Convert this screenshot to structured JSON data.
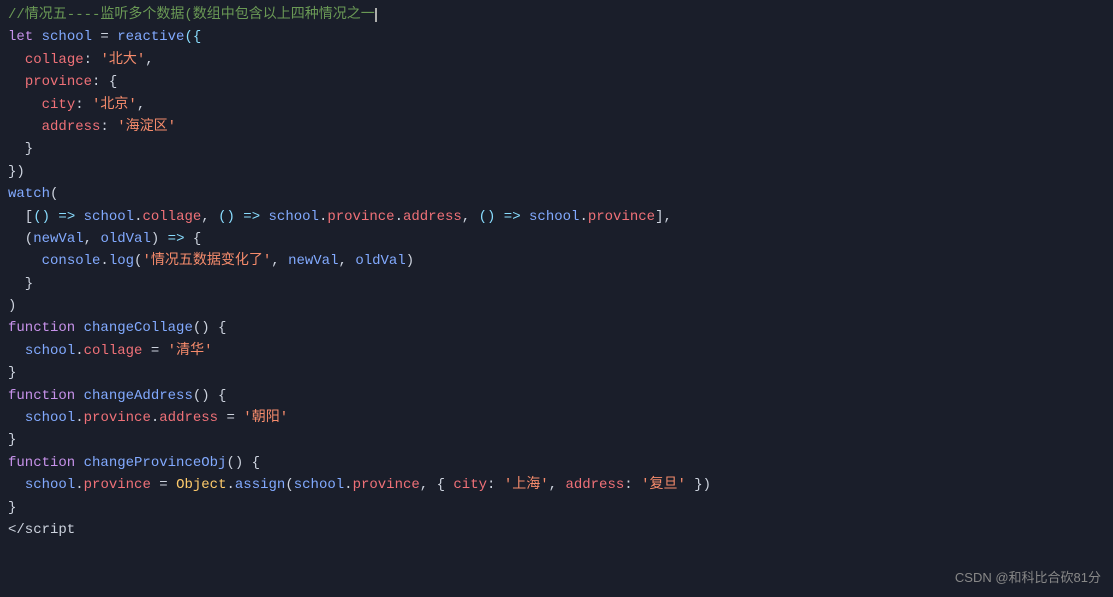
{
  "editor": {
    "background": "#1a1e2a",
    "watermark": "CSDN @和科比合砍81分"
  },
  "lines": [
    {
      "id": 1,
      "type": "comment",
      "text": "//情况五----监听多个数据(数组中包含以上四种情况之一"
    },
    {
      "id": 2,
      "type": "code",
      "text": "let school = reactive({"
    },
    {
      "id": 3,
      "type": "code",
      "text": "  collage: '北大',"
    },
    {
      "id": 4,
      "type": "code",
      "text": "  province: {"
    },
    {
      "id": 5,
      "type": "code",
      "text": "    city: '北京',"
    },
    {
      "id": 6,
      "type": "code",
      "text": "    address: '海淀区'"
    },
    {
      "id": 7,
      "type": "code",
      "text": "  }"
    },
    {
      "id": 8,
      "type": "code",
      "text": "})"
    },
    {
      "id": 9,
      "type": "code",
      "text": "watch("
    },
    {
      "id": 10,
      "type": "code",
      "text": "  [() => school.collage, () => school.province.address, () => school.province],"
    },
    {
      "id": 11,
      "type": "code",
      "text": "  (newVal, oldVal) => {"
    },
    {
      "id": 12,
      "type": "code",
      "text": "    console.log('情况五数据变化了', newVal, oldVal)"
    },
    {
      "id": 13,
      "type": "code",
      "text": "  }"
    },
    {
      "id": 14,
      "type": "code",
      "text": ")"
    },
    {
      "id": 15,
      "type": "code",
      "text": "function changeCollage() {"
    },
    {
      "id": 16,
      "type": "code",
      "text": "  school.collage = '清华'"
    },
    {
      "id": 17,
      "type": "code",
      "text": "}"
    },
    {
      "id": 18,
      "type": "code",
      "text": "function changeAddress() {"
    },
    {
      "id": 19,
      "type": "code",
      "text": "  school.province.address = '朝阳'"
    },
    {
      "id": 20,
      "type": "code",
      "text": "}"
    },
    {
      "id": 21,
      "type": "code",
      "text": "function changeProvinceObj() {"
    },
    {
      "id": 22,
      "type": "code",
      "text": "  school.province = Object.assign(school.province, { city: '上海', address: '复旦' })"
    },
    {
      "id": 23,
      "type": "code",
      "text": "}"
    },
    {
      "id": 24,
      "type": "code",
      "text": "</script"
    }
  ]
}
